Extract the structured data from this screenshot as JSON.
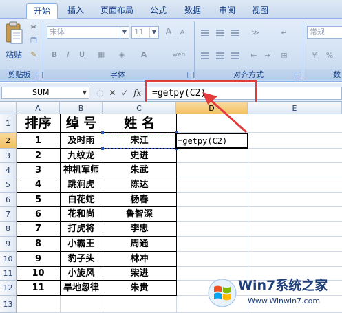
{
  "ribbon": {
    "tabs": [
      {
        "label": "开始",
        "active": true
      },
      {
        "label": "插入",
        "active": false
      },
      {
        "label": "页面布局",
        "active": false
      },
      {
        "label": "公式",
        "active": false
      },
      {
        "label": "数据",
        "active": false
      },
      {
        "label": "审阅",
        "active": false
      },
      {
        "label": "视图",
        "active": false
      }
    ],
    "clipboard": {
      "paste_label": "粘贴",
      "group_label": "剪贴板"
    },
    "font": {
      "name": "宋体",
      "size": "11",
      "group_label": "字体",
      "grow_label": "A",
      "shrink_label": "A",
      "bold": "B",
      "italic": "I",
      "underline": "U",
      "wen": "wén"
    },
    "alignment": {
      "group_label": "对齐方式"
    },
    "number": {
      "format": "常规",
      "group_label": "数"
    }
  },
  "formula_bar": {
    "name_box": "SUM",
    "fx_label": "fx",
    "cancel_label": "✕",
    "enter_label": "✓",
    "formula": "=getpy(C2)"
  },
  "columns": [
    "A",
    "B",
    "C",
    "D",
    "E"
  ],
  "rows": [
    "1",
    "2",
    "3",
    "4",
    "5",
    "6",
    "7",
    "8",
    "9",
    "10",
    "11",
    "12",
    "13"
  ],
  "table": {
    "headers": [
      "排序",
      "绰 号",
      "姓 名"
    ],
    "rows": [
      [
        "1",
        "及时雨",
        "宋江"
      ],
      [
        "2",
        "九纹龙",
        "史进"
      ],
      [
        "3",
        "神机军师",
        "朱武"
      ],
      [
        "4",
        "跳涧虎",
        "陈达"
      ],
      [
        "5",
        "白花蛇",
        "杨春"
      ],
      [
        "6",
        "花和尚",
        "鲁智深"
      ],
      [
        "7",
        "打虎将",
        "李忠"
      ],
      [
        "8",
        "小霸王",
        "周通"
      ],
      [
        "9",
        "豹子头",
        "林冲"
      ],
      [
        "10",
        "小旋风",
        "柴进"
      ],
      [
        "11",
        "旱地忽律",
        "朱贵"
      ]
    ]
  },
  "active_cell": {
    "ref": "D2",
    "content": "=getpy(C2)"
  },
  "watermark": {
    "title": "Win7系统之家",
    "url": "Www.Winwin7.com"
  },
  "colors": {
    "selection": "#f1c15f",
    "annotation": "#e33b3b",
    "ribbon_text": "#15428b"
  }
}
